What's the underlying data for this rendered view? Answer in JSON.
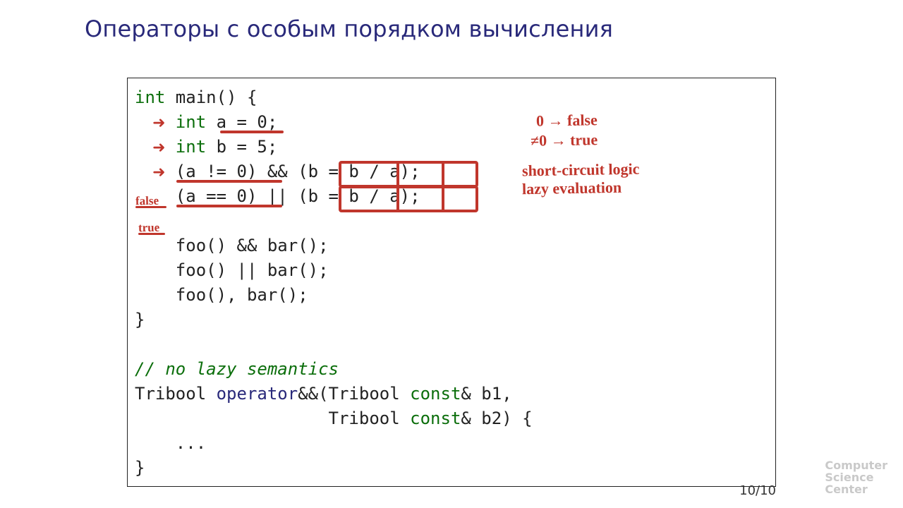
{
  "slide": {
    "title": "Операторы с особым порядком вычисления",
    "page": "10/10",
    "logo_l1": "Computer",
    "logo_l2": "Science",
    "logo_l3": "Center"
  },
  "code": {
    "l1_kw": "int",
    "l1_rest": " main() {",
    "l2_pad": "    ",
    "l2_kw": "int",
    "l2_rest": " a = 0;",
    "l3_pad": "    ",
    "l3_kw": "int",
    "l3_rest": " b = 5;",
    "l4": "    (a != 0) && (b = b / a);",
    "l5": "    (a == 0) || (b = b / a);",
    "blank1": "",
    "l6": "    foo() && bar();",
    "l7": "    foo() || bar();",
    "l8": "    foo(), bar();",
    "l9": "}",
    "blank2": "",
    "l10_cm": "// no lazy semantics",
    "l11a": "Tribool ",
    "l11_op": "operator",
    "l11b": "&&(Tribool ",
    "l11_kw": "const",
    "l11c": "& b1,",
    "l12a": "                   Tribool ",
    "l12_kw": "const",
    "l12b": "& b2) {",
    "l13": "    ...",
    "l14": "}"
  },
  "annotations": {
    "note1": "0 → false",
    "note2": "≠0 → true",
    "note3": "short-circuit logic",
    "note4": "lazy evaluation",
    "label_false": "false",
    "label_true": "true"
  }
}
